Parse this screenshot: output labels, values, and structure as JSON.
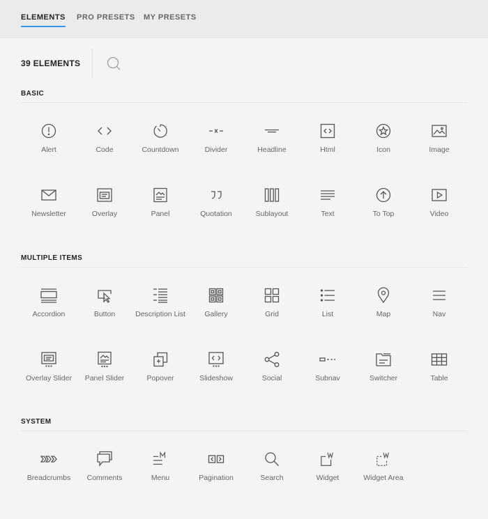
{
  "tabs": [
    {
      "label": "ELEMENTS",
      "active": true
    },
    {
      "label": "PRO PRESETS",
      "active": false
    },
    {
      "label": "MY PRESETS",
      "active": false
    }
  ],
  "element_count": "39 ELEMENTS",
  "accent_color": "#3696f3",
  "sections": [
    {
      "title": "BASIC",
      "items": [
        {
          "label": "Alert",
          "icon": "alert-icon"
        },
        {
          "label": "Code",
          "icon": "code-icon"
        },
        {
          "label": "Countdown",
          "icon": "countdown-icon"
        },
        {
          "label": "Divider",
          "icon": "divider-icon"
        },
        {
          "label": "Headline",
          "icon": "headline-icon"
        },
        {
          "label": "Html",
          "icon": "html-icon"
        },
        {
          "label": "Icon",
          "icon": "star-icon"
        },
        {
          "label": "Image",
          "icon": "image-icon"
        },
        {
          "label": "Newsletter",
          "icon": "newsletter-icon"
        },
        {
          "label": "Overlay",
          "icon": "overlay-icon"
        },
        {
          "label": "Panel",
          "icon": "panel-icon"
        },
        {
          "label": "Quotation",
          "icon": "quotation-icon"
        },
        {
          "label": "Sublayout",
          "icon": "sublayout-icon"
        },
        {
          "label": "Text",
          "icon": "text-icon"
        },
        {
          "label": "To Top",
          "icon": "to-top-icon"
        },
        {
          "label": "Video",
          "icon": "video-icon"
        }
      ]
    },
    {
      "title": "MULTIPLE ITEMS",
      "items": [
        {
          "label": "Accordion",
          "icon": "accordion-icon"
        },
        {
          "label": "Button",
          "icon": "button-icon"
        },
        {
          "label": "Description List",
          "icon": "description-list-icon"
        },
        {
          "label": "Gallery",
          "icon": "gallery-icon"
        },
        {
          "label": "Grid",
          "icon": "grid-icon"
        },
        {
          "label": "List",
          "icon": "list-icon"
        },
        {
          "label": "Map",
          "icon": "map-pin-icon"
        },
        {
          "label": "Nav",
          "icon": "nav-icon"
        },
        {
          "label": "Overlay Slider",
          "icon": "overlay-slider-icon"
        },
        {
          "label": "Panel Slider",
          "icon": "panel-slider-icon"
        },
        {
          "label": "Popover",
          "icon": "popover-icon"
        },
        {
          "label": "Slideshow",
          "icon": "slideshow-icon"
        },
        {
          "label": "Social",
          "icon": "social-icon"
        },
        {
          "label": "Subnav",
          "icon": "subnav-icon"
        },
        {
          "label": "Switcher",
          "icon": "switcher-icon"
        },
        {
          "label": "Table",
          "icon": "table-icon"
        }
      ]
    },
    {
      "title": "SYSTEM",
      "items": [
        {
          "label": "Breadcrumbs",
          "icon": "breadcrumbs-icon"
        },
        {
          "label": "Comments",
          "icon": "comments-icon"
        },
        {
          "label": "Menu",
          "icon": "menu-icon"
        },
        {
          "label": "Pagination",
          "icon": "pagination-icon"
        },
        {
          "label": "Search",
          "icon": "search-element-icon"
        },
        {
          "label": "Widget",
          "icon": "widget-icon"
        },
        {
          "label": "Widget Area",
          "icon": "widget-area-icon"
        }
      ]
    }
  ]
}
